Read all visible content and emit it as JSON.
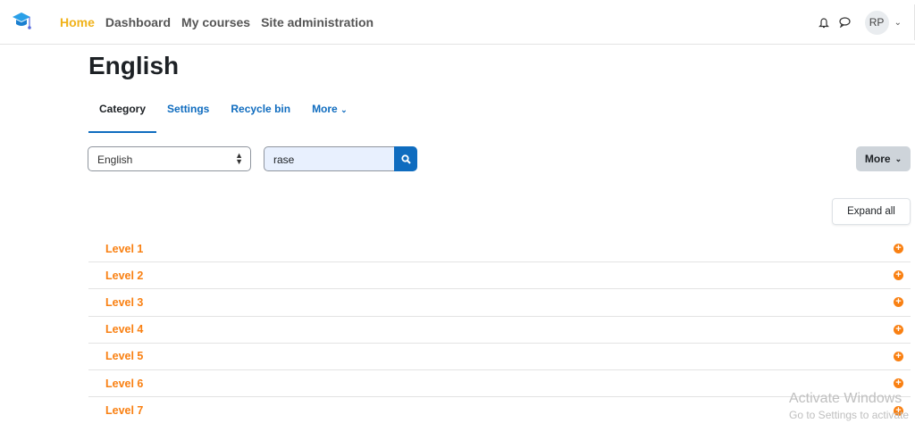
{
  "nav": {
    "links": [
      "Home",
      "Dashboard",
      "My courses",
      "Site administration"
    ],
    "avatar": "RP"
  },
  "page": {
    "title": "English"
  },
  "tabs": [
    "Category",
    "Settings",
    "Recycle bin",
    "More"
  ],
  "controls": {
    "category_select": "English",
    "search_value": "rase",
    "more_label": "More",
    "expand_all": "Expand all"
  },
  "categories": [
    "Level 1",
    "Level 2",
    "Level 3",
    "Level 4",
    "Level 5",
    "Level 6",
    "Level 7"
  ],
  "watermark": {
    "line1": "Activate Windows",
    "line2": "Go to Settings to activate"
  },
  "colors": {
    "accent": "#0f6cbf",
    "brand_orange": "#f98012",
    "home_active": "#f0b21a"
  }
}
